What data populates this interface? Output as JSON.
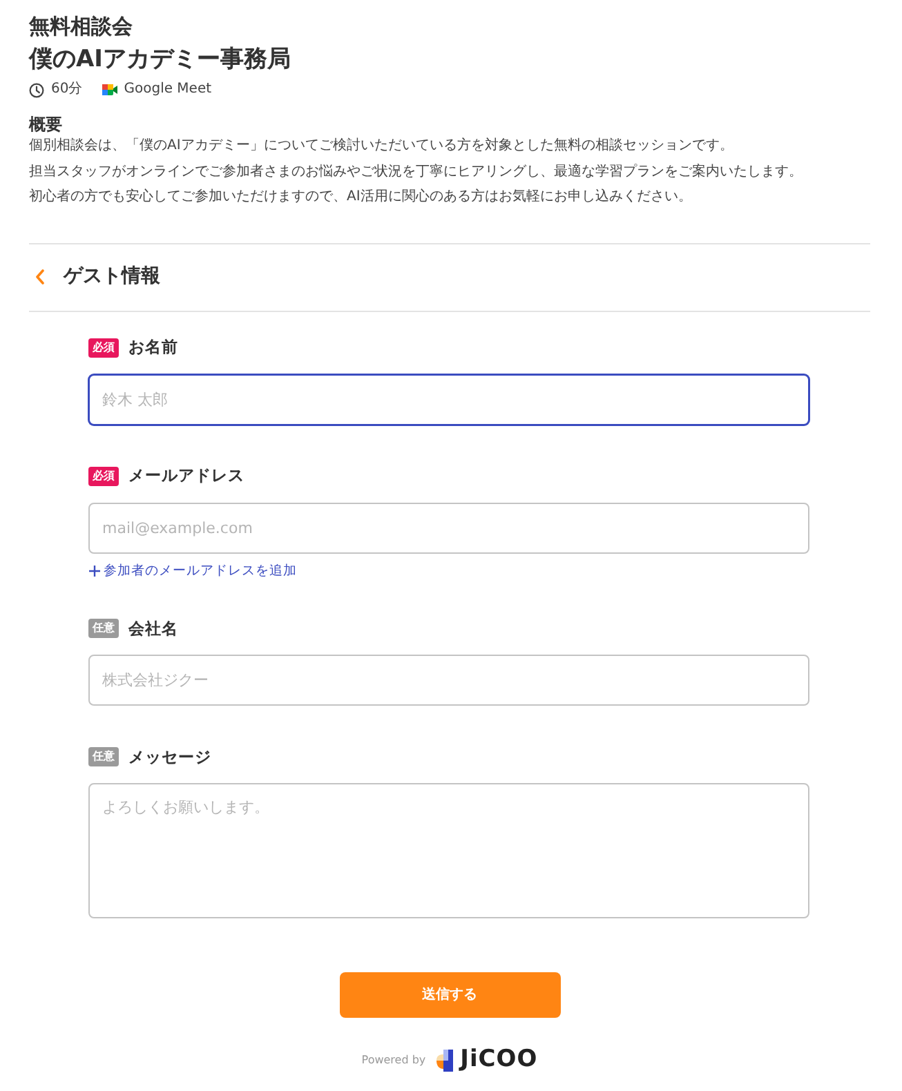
{
  "event": {
    "category": "無料相談会",
    "title": "僕のAIアカデミー事務局",
    "duration": "60分",
    "platform": "Google Meet"
  },
  "overview": {
    "heading": "概要",
    "lines": [
      "個別相談会は、「僕のAIアカデミー」についてご検討いただいている方を対象とした無料の相談セッションです。",
      "担当スタッフがオンラインでご参加者さまのお悩みやご状況を丁寧にヒアリングし、最適な学習プランをご案内いたします。",
      "初心者の方でも安心してご参加いただけますので、AI活用に関心のある方はお気軽にお申し込みください。"
    ]
  },
  "section": {
    "title": "ゲスト情報"
  },
  "fields": [
    {
      "kind": "input",
      "required": true,
      "badge": "必須",
      "label": "お名前",
      "placeholder": "鈴木 太郎",
      "focused": true
    },
    {
      "kind": "input",
      "required": true,
      "badge": "必須",
      "label": "メールアドレス",
      "placeholder": "mail@example.com",
      "focused": false,
      "add_link": "参加者のメールアドレスを追加"
    },
    {
      "kind": "input",
      "required": false,
      "badge": "任意",
      "label": "会社名",
      "placeholder": "株式会社ジクー",
      "focused": false
    },
    {
      "kind": "textarea",
      "required": false,
      "badge": "任意",
      "label": "メッセージ",
      "placeholder": "よろしくお願いします。",
      "focused": false
    }
  ],
  "submit": "送信する",
  "footer": {
    "powered_by": "Powered by",
    "brand": "JiCOO"
  }
}
